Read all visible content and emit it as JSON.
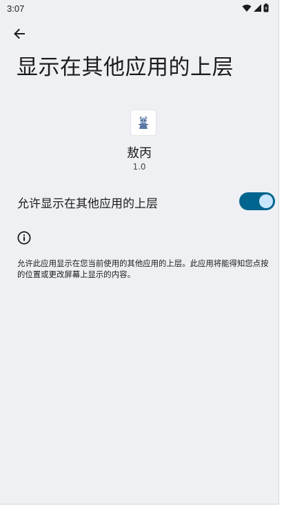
{
  "status_bar": {
    "time": "3:07",
    "icons": [
      "wifi-icon",
      "cellular-signal-icon",
      "battery-icon"
    ]
  },
  "header": {
    "back_icon": "arrow-back-icon",
    "title": "显示在其他应用的上层"
  },
  "app": {
    "icon": "app-logo-icon",
    "name": "敖丙",
    "version": "1.0"
  },
  "setting": {
    "label": "允许显示在其他应用的上层",
    "enabled": true
  },
  "info": {
    "icon": "info-icon",
    "description": "允许此应用显示在您当前使用的其他应用的上层。此应用将能得知您点按的位置或更改屏幕上显示的内容。"
  },
  "colors": {
    "background": "#eef0f3",
    "switch_track_on": "#00658e",
    "switch_thumb_on": "#c9e6ff",
    "text_primary": "#1c1b1f"
  }
}
